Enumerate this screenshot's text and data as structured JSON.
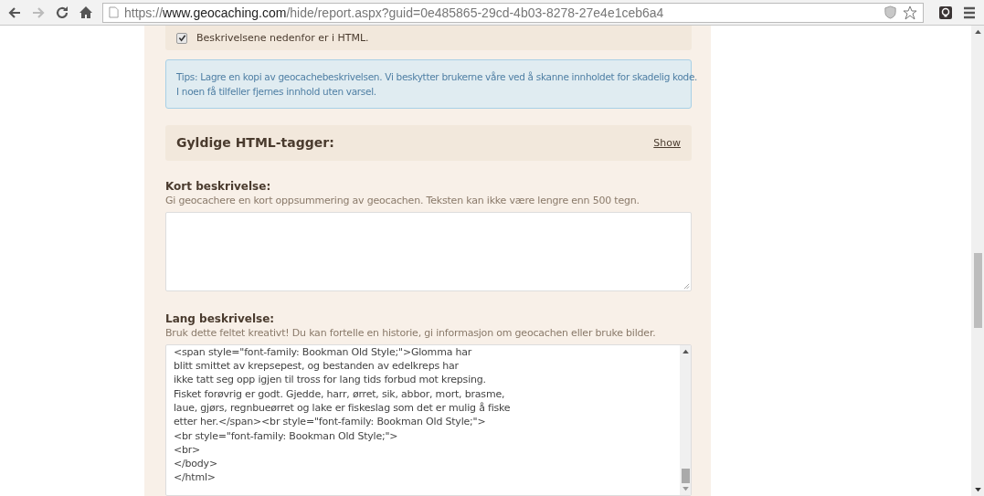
{
  "browser": {
    "url_scheme": "https://",
    "url_host": "www.geocaching.com",
    "url_path": "/hide/report.aspx?guid=0e485865-29cd-4b03-8278-27e4e1ceb6a4"
  },
  "html_option": {
    "label": "Beskrivelsene nedenfor er i HTML.",
    "checked": true
  },
  "tip": {
    "lines": [
      "Tips: Lagre en kopi av geocachebeskrivelsen. Vi beskytter brukerne våre ved å skanne innholdet for skadelig kode.",
      "I noen få tilfeller fjernes innhold uten varsel."
    ]
  },
  "html_tags": {
    "title": "Gyldige HTML-tagger:",
    "link": "Show"
  },
  "short_description": {
    "label": "Kort beskrivelse:",
    "hint": "Gi geocachere en kort oppsummering av geocachen. Teksten kan ikke være lengre enn 500 tegn."
  },
  "long_description": {
    "label": "Lang beskrivelse:",
    "hint": "Bruk dette feltet kreativt! Du kan fortelle en historie, gi informasjon om geocachen eller bruke bilder.",
    "lines": [
      "<span style=\"font-family: Bookman Old Style;\">Glomma har",
      "blitt smittet av krepsepest, og bestanden av edelkreps har",
      "ikke tatt seg opp igjen til tross for lang tids forbud mot krepsing.",
      "Fisket forøvrig er godt. Gjedde, harr, ørret, sik, abbor, mort, brasme,",
      "laue, gjørs, regnbueørret og lake er fiskeslag som det er mulig å fiske",
      "etter her.</span><br style=\"font-family: Bookman Old Style;\">",
      "<br style=\"font-family: Bookman Old Style;\">",
      "<br>",
      "</body>",
      "</html>"
    ]
  }
}
